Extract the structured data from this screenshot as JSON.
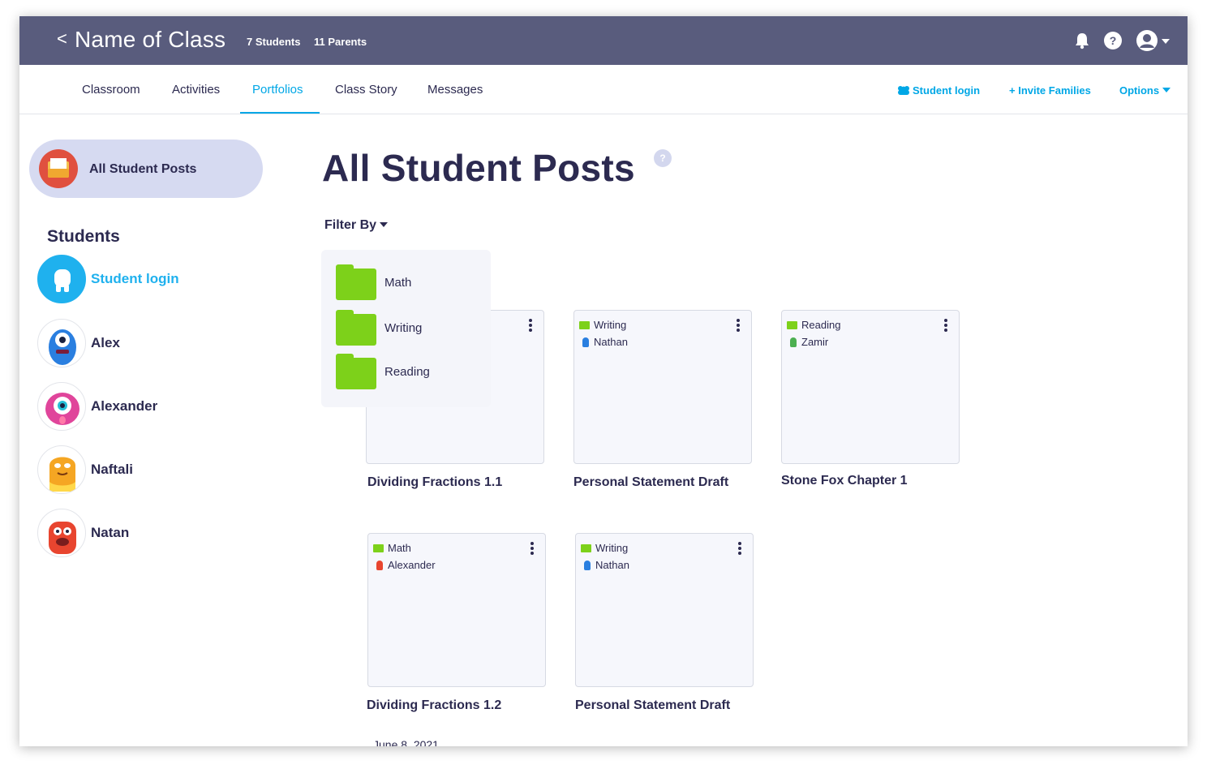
{
  "header": {
    "back": "<",
    "class_name": "Name of Class",
    "students_count": "7 Students",
    "parents_count": "11 Parents",
    "help": "?"
  },
  "tabs": [
    {
      "label": "Classroom"
    },
    {
      "label": "Activities"
    },
    {
      "label": "Portfolios",
      "active": true
    },
    {
      "label": "Class Story"
    },
    {
      "label": "Messages"
    }
  ],
  "top_actions": {
    "student_login": "Student login",
    "invite_families": "+ Invite Families",
    "options": "Options"
  },
  "sidebar": {
    "all_posts": "All Student Posts",
    "students_heading": "Students",
    "student_login": "Student login",
    "students": [
      {
        "name": "Alex",
        "color": "#2a7fe0"
      },
      {
        "name": "Alexander",
        "color": "#e0459b"
      },
      {
        "name": "Naftali",
        "color": "#f5a623"
      },
      {
        "name": "Natan",
        "color": "#e8452f"
      }
    ]
  },
  "main": {
    "title": "All Student Posts",
    "help": "?",
    "filter_label": "Filter By",
    "filter_options": [
      "Math",
      "Writing",
      "Reading"
    ],
    "date_peek": "June 8, 2021"
  },
  "posts": [
    {
      "folder": "",
      "student": "",
      "title": "Dividing Fractions 1.1"
    },
    {
      "folder": "Writing",
      "student": "Nathan",
      "title": "Personal Statement Draft"
    },
    {
      "folder": "Reading",
      "student": "Zamir",
      "title": "Stone Fox Chapter 1"
    },
    {
      "folder": "Math",
      "student": "Alexander",
      "title": "Dividing Fractions 1.2"
    },
    {
      "folder": "Writing",
      "student": "Nathan",
      "title": "Personal Statement Draft"
    }
  ],
  "colors": {
    "header_bg": "#595c7d",
    "accent": "#00a7e6",
    "text_dark": "#2c2a50",
    "folder_green": "#7dd11a",
    "pill_bg": "#d6daf1"
  }
}
